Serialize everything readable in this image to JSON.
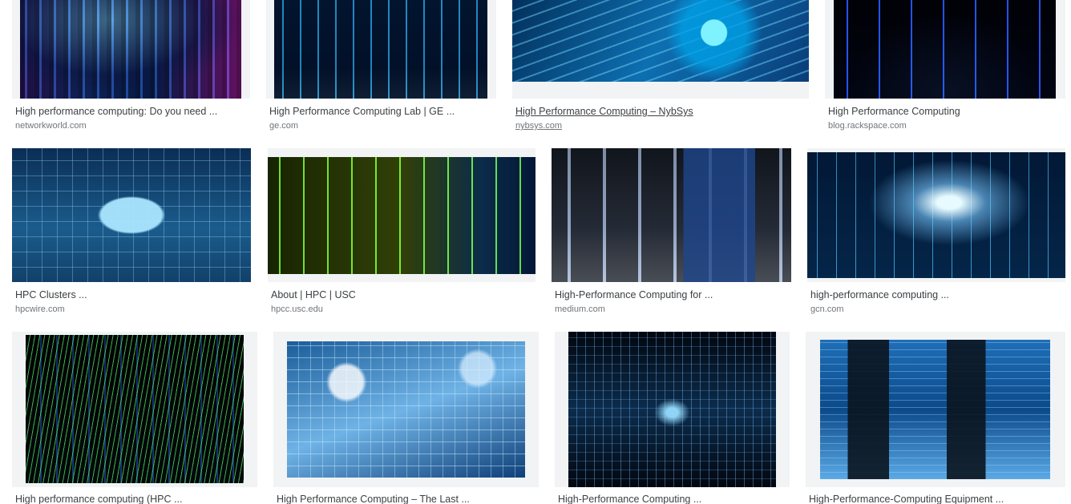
{
  "results": [
    {
      "title": "High performance computing: Do you need ...",
      "source": "networkworld.com",
      "art": "servers-purple-icon"
    },
    {
      "title": "High Performance Computing Lab | GE ...",
      "source": "ge.com",
      "art": "server-corridor-icon"
    },
    {
      "title": "High Performance Computing – NybSys",
      "source": "nybsys.com",
      "art": "circuit-chip-icon",
      "hovered": true
    },
    {
      "title": "High Performance Computing",
      "source": "blog.rackspace.com",
      "art": "dark-server-room-icon"
    },
    {
      "title": "HPC Clusters ...",
      "source": "hpcwire.com",
      "art": "cloud-network-icon"
    },
    {
      "title": "About | HPC | USC",
      "source": "hpcc.usc.edu",
      "art": "green-server-aisle-icon"
    },
    {
      "title": "High-Performance Computing for ...",
      "source": "medium.com",
      "art": "rack-laptop-icon"
    },
    {
      "title": "high-performance computing ...",
      "source": "gcn.com",
      "art": "datacenter-corridor-icon"
    },
    {
      "title": "High performance computing (HPC ...",
      "source": "",
      "art": "green-data-streams-icon"
    },
    {
      "title": "High Performance Computing – The Last ...",
      "source": "",
      "art": "binary-landscape-icon"
    },
    {
      "title": "High-Performance Computing ...",
      "source": "",
      "art": "light-tunnel-icon"
    },
    {
      "title": "High-Performance-Computing Equipment ...",
      "source": "",
      "art": "hpc-equipment-rack-icon"
    }
  ]
}
